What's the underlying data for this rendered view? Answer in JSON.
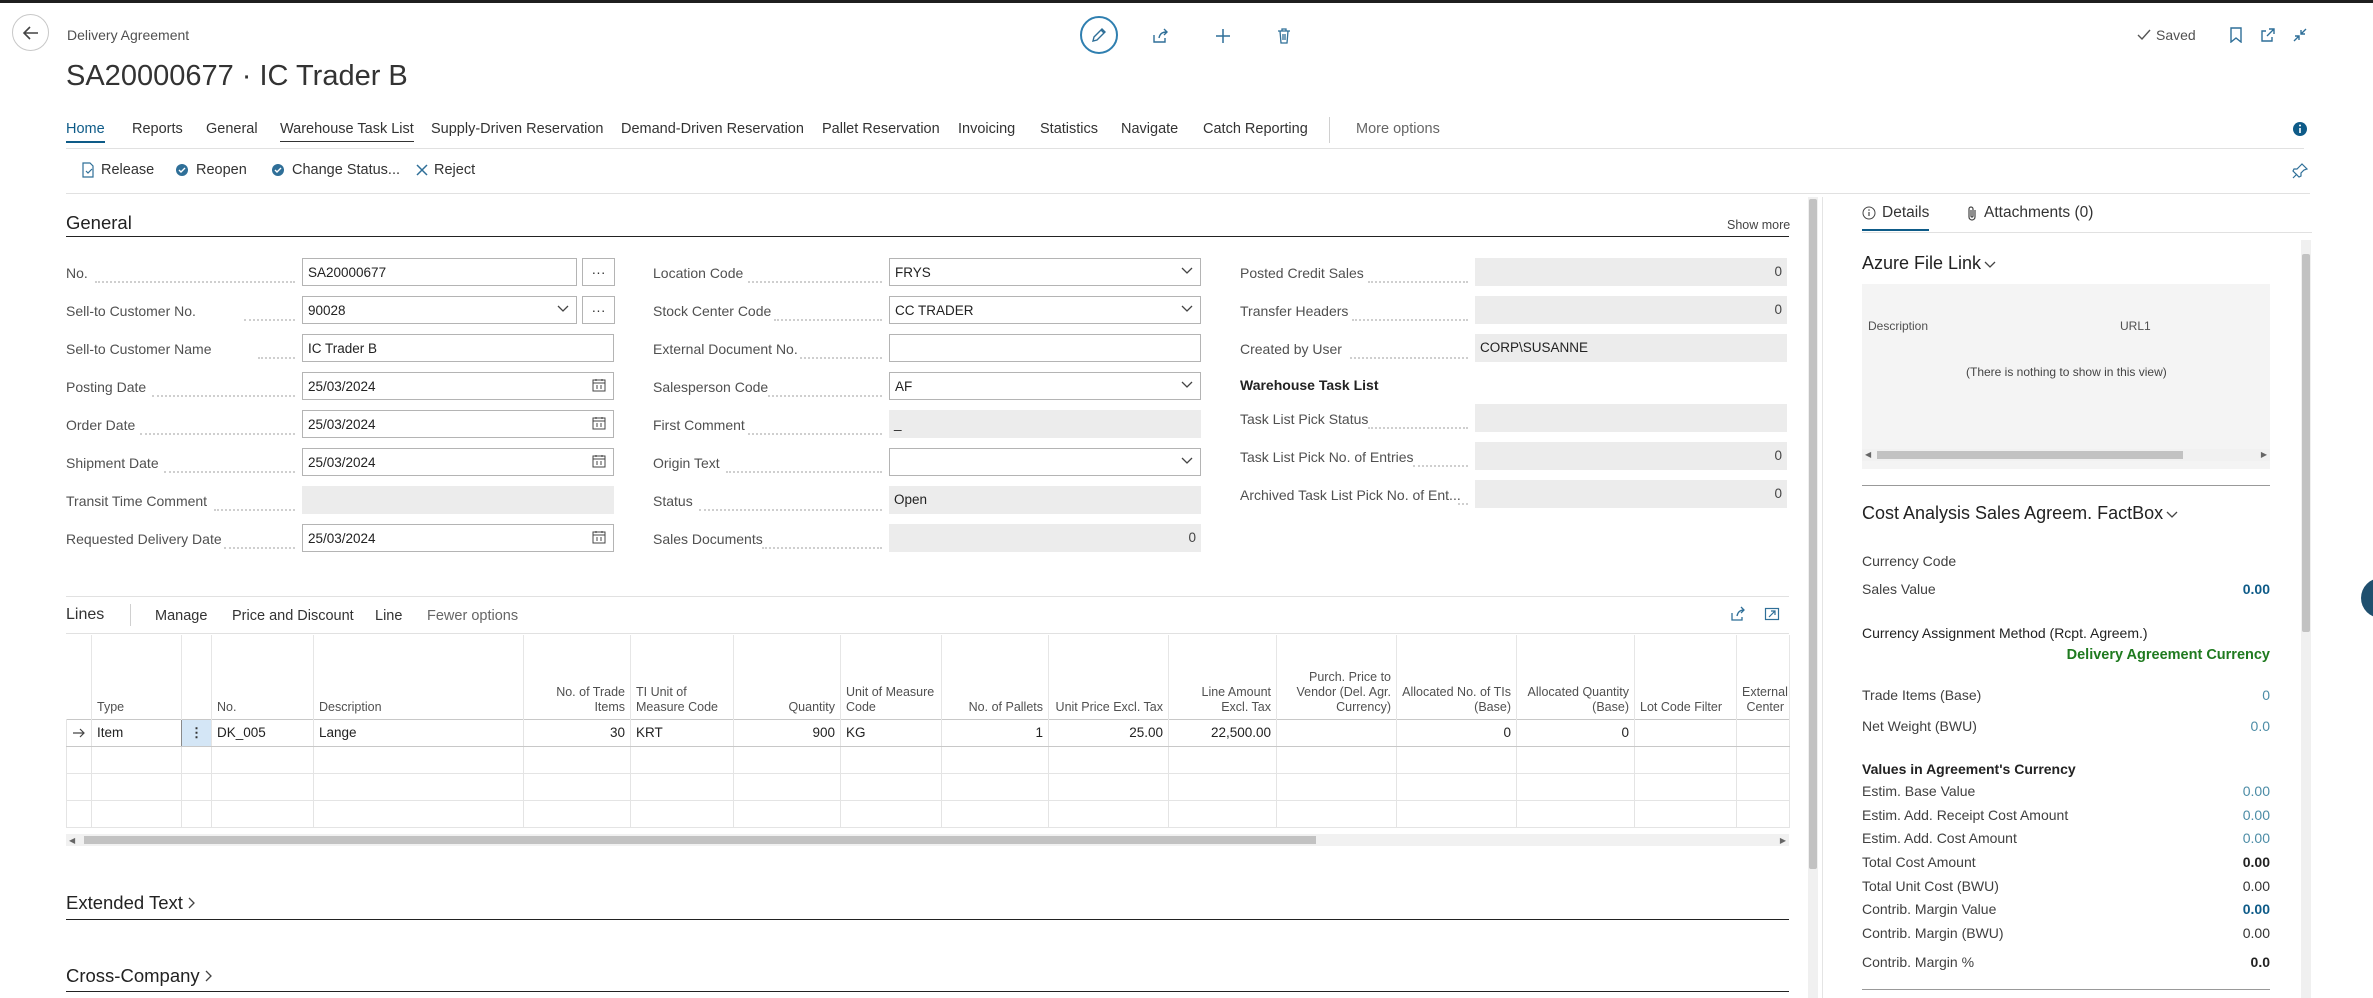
{
  "header": {
    "breadcrumb": "Delivery Agreement",
    "title": "SA20000677 · IC Trader B",
    "saved": "Saved"
  },
  "tabs": [
    {
      "label": "Home",
      "state": "active"
    },
    {
      "label": "Reports"
    },
    {
      "label": "General"
    },
    {
      "label": "Warehouse Task List",
      "state": "underlined"
    },
    {
      "label": "Supply-Driven Reservation"
    },
    {
      "label": "Demand-Driven Reservation"
    },
    {
      "label": "Pallet Reservation"
    },
    {
      "label": "Invoicing"
    },
    {
      "label": "Statistics"
    },
    {
      "label": "Navigate"
    },
    {
      "label": "Catch Reporting"
    },
    {
      "label": "More options"
    }
  ],
  "promoted_actions": [
    "Release",
    "Reopen",
    "Change Status...",
    "Reject"
  ],
  "general": {
    "title": "General",
    "show_more": "Show more",
    "col1": [
      {
        "label": "No.",
        "value": "SA20000677"
      },
      {
        "label": "Sell-to Customer No.",
        "value": "90028"
      },
      {
        "label": "Sell-to Customer Name",
        "value": "IC Trader B"
      },
      {
        "label": "Posting Date",
        "value": "25/03/2024"
      },
      {
        "label": "Order Date",
        "value": "25/03/2024"
      },
      {
        "label": "Shipment Date",
        "value": "25/03/2024"
      },
      {
        "label": "Transit Time Comment",
        "value": ""
      },
      {
        "label": "Requested Delivery Date",
        "value": "25/03/2024"
      }
    ],
    "col2": [
      {
        "label": "Location Code",
        "value": "FRYS"
      },
      {
        "label": "Stock Center Code",
        "value": "CC TRADER"
      },
      {
        "label": "External Document No.",
        "value": ""
      },
      {
        "label": "Salesperson Code",
        "value": "AF"
      },
      {
        "label": "First Comment",
        "value": "_"
      },
      {
        "label": "Origin Text",
        "value": ""
      },
      {
        "label": "Status",
        "value": "Open"
      },
      {
        "label": "Sales Documents",
        "value": "0"
      }
    ],
    "col3": [
      {
        "label": "Posted Credit Sales",
        "value": "0"
      },
      {
        "label": "Transfer Headers",
        "value": "0"
      },
      {
        "label": "Created by User",
        "value": "CORP\\SUSANNE"
      }
    ],
    "wtl_title": "Warehouse Task List",
    "col3b": [
      {
        "label": "Task List Pick Status",
        "value": ""
      },
      {
        "label": "Task List Pick No. of Entries",
        "value": "0"
      },
      {
        "label": "Archived Task List Pick No. of Ent...",
        "value": "0"
      }
    ]
  },
  "lines": {
    "title": "Lines",
    "actions": [
      "Manage",
      "Price and Discount",
      "Line",
      "Fewer options"
    ],
    "columns": [
      "Type",
      "No.",
      "Description",
      "No. of Trade Items",
      "TI Unit of Measure Code",
      "Quantity",
      "Unit of Measure Code",
      "No. of Pallets",
      "Unit Price Excl. Tax",
      "Line Amount Excl. Tax",
      "Purch. Price to Vendor (Del. Agr. Currency)",
      "Allocated No. of TIs (Base)",
      "Allocated Quantity (Base)",
      "Lot Code Filter",
      "External Center"
    ],
    "rows": [
      [
        "Item",
        "DK_005",
        "Lange",
        "30",
        "KRT",
        "900",
        "KG",
        "1",
        "25.00",
        "22,500.00",
        "",
        "0",
        "0",
        "",
        ""
      ]
    ]
  },
  "sections": [
    "Extended Text",
    "Cross-Company"
  ],
  "factbox": {
    "tabs": [
      "Details",
      "Attachments (0)"
    ],
    "azure": {
      "title": "Azure File Link",
      "col1": "Description",
      "col2": "URL1",
      "empty": "(There is nothing to show in this view)"
    },
    "cost": {
      "title": "Cost Analysis Sales Agreem. FactBox",
      "currency_code_label": "Currency Code",
      "sales_value_label": "Sales Value",
      "sales_value": "0.00",
      "cam_label": "Currency Assignment Method (Rcpt. Agreem.)",
      "cam_value": "Delivery Agreement Currency",
      "trade_items_label": "Trade Items (Base)",
      "trade_items": "0",
      "net_weight_label": "Net Weight (BWU)",
      "net_weight": "0.0",
      "values_title": "Values in Agreement's Currency",
      "values": [
        {
          "label": "Estim. Base Value",
          "value": "0.00",
          "style": "link"
        },
        {
          "label": "Estim. Add. Receipt Cost Amount",
          "value": "0.00",
          "style": "link"
        },
        {
          "label": "Estim. Add. Cost Amount",
          "value": "0.00",
          "style": "link"
        },
        {
          "label": "Total Cost Amount",
          "value": "0.00",
          "style": "bold"
        },
        {
          "label": "Total Unit Cost (BWU)",
          "value": "0.00",
          "style": "plain"
        },
        {
          "label": "Contrib. Margin Value",
          "value": "0.00",
          "style": "boldlink"
        },
        {
          "label": "Contrib. Margin (BWU)",
          "value": "0.00",
          "style": "plain"
        },
        {
          "label": "Contrib. Margin %",
          "value": "0.0",
          "style": "bold"
        }
      ]
    }
  }
}
